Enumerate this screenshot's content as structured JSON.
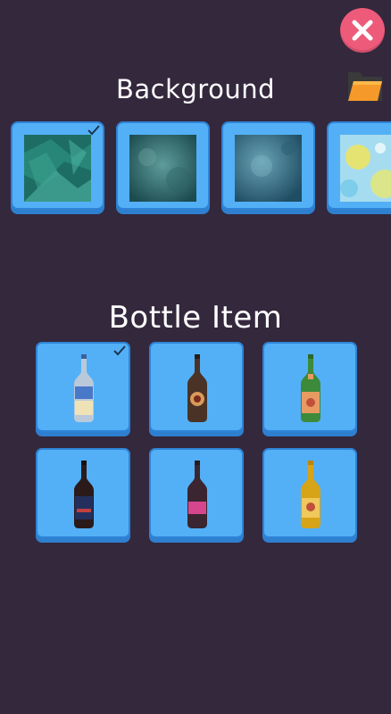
{
  "header": {
    "close_icon": "close-icon",
    "folder_icon": "folder-icon"
  },
  "background_section": {
    "title": "Background",
    "items": [
      {
        "name": "green-marble",
        "selected": true,
        "color_a": "#1d6d64",
        "color_b": "#4fb7a3"
      },
      {
        "name": "dark-teal-grunge",
        "selected": false,
        "color_a": "#1c4c50",
        "color_b": "#5f9c9a"
      },
      {
        "name": "blue-grunge",
        "selected": false,
        "color_a": "#1f4d63",
        "color_b": "#6aa3b6"
      },
      {
        "name": "yellow-watercolor",
        "selected": false,
        "color_a": "#9fd7ef",
        "color_b": "#f0e45c"
      }
    ]
  },
  "bottle_section": {
    "title": "Bottle Item",
    "items": [
      {
        "name": "blue-label-bottle",
        "selected": true,
        "glass": "#b9c9da",
        "label": "#4a78c9"
      },
      {
        "name": "brown-round-label-bottle",
        "selected": false,
        "glass": "#4a3326",
        "label": "#d99a5a"
      },
      {
        "name": "green-bottle",
        "selected": false,
        "glass": "#3d8a3a",
        "label": "#e79b61"
      },
      {
        "name": "dark-navy-label-bottle",
        "selected": false,
        "glass": "#2b1a1a",
        "label": "#23305e"
      },
      {
        "name": "pink-label-bottle",
        "selected": false,
        "glass": "#3a2530",
        "label": "#d6468f"
      },
      {
        "name": "yellow-bottle",
        "selected": false,
        "glass": "#d7a317",
        "label": "#f0c85b"
      }
    ]
  },
  "colors": {
    "background": "#34283d",
    "card": "#53b0f6",
    "card_border": "#2f83d6",
    "close": "#ee5b7a"
  }
}
